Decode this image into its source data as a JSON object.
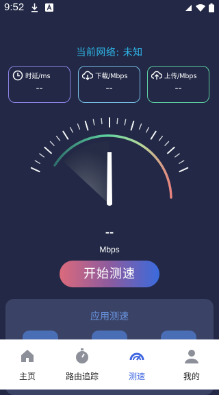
{
  "status_bar": {
    "time": "9:52"
  },
  "network": {
    "label": "当前网络: 未知"
  },
  "metrics": [
    {
      "label": "时延/ms",
      "value": "--",
      "icon": "clock-icon"
    },
    {
      "label": "下载/Mbps",
      "value": "--",
      "icon": "cloud-download-icon"
    },
    {
      "label": "上传/Mbps",
      "value": "--",
      "icon": "cloud-upload-icon"
    }
  ],
  "gauge": {
    "speed": "--",
    "unit": "Mbps"
  },
  "start_button": {
    "label": "开始测速"
  },
  "app_speed": {
    "title": "应用测速"
  },
  "bottom_nav": [
    {
      "label": "主页",
      "icon": "home-icon"
    },
    {
      "label": "路由追踪",
      "icon": "stopwatch-icon"
    },
    {
      "label": "测速",
      "icon": "speedometer-icon"
    },
    {
      "label": "我的",
      "icon": "user-icon"
    }
  ],
  "colors": {
    "background": "#222845",
    "accent": "#3F66E0",
    "network_text": "#2EB6E8",
    "panel": "#3A4266"
  }
}
